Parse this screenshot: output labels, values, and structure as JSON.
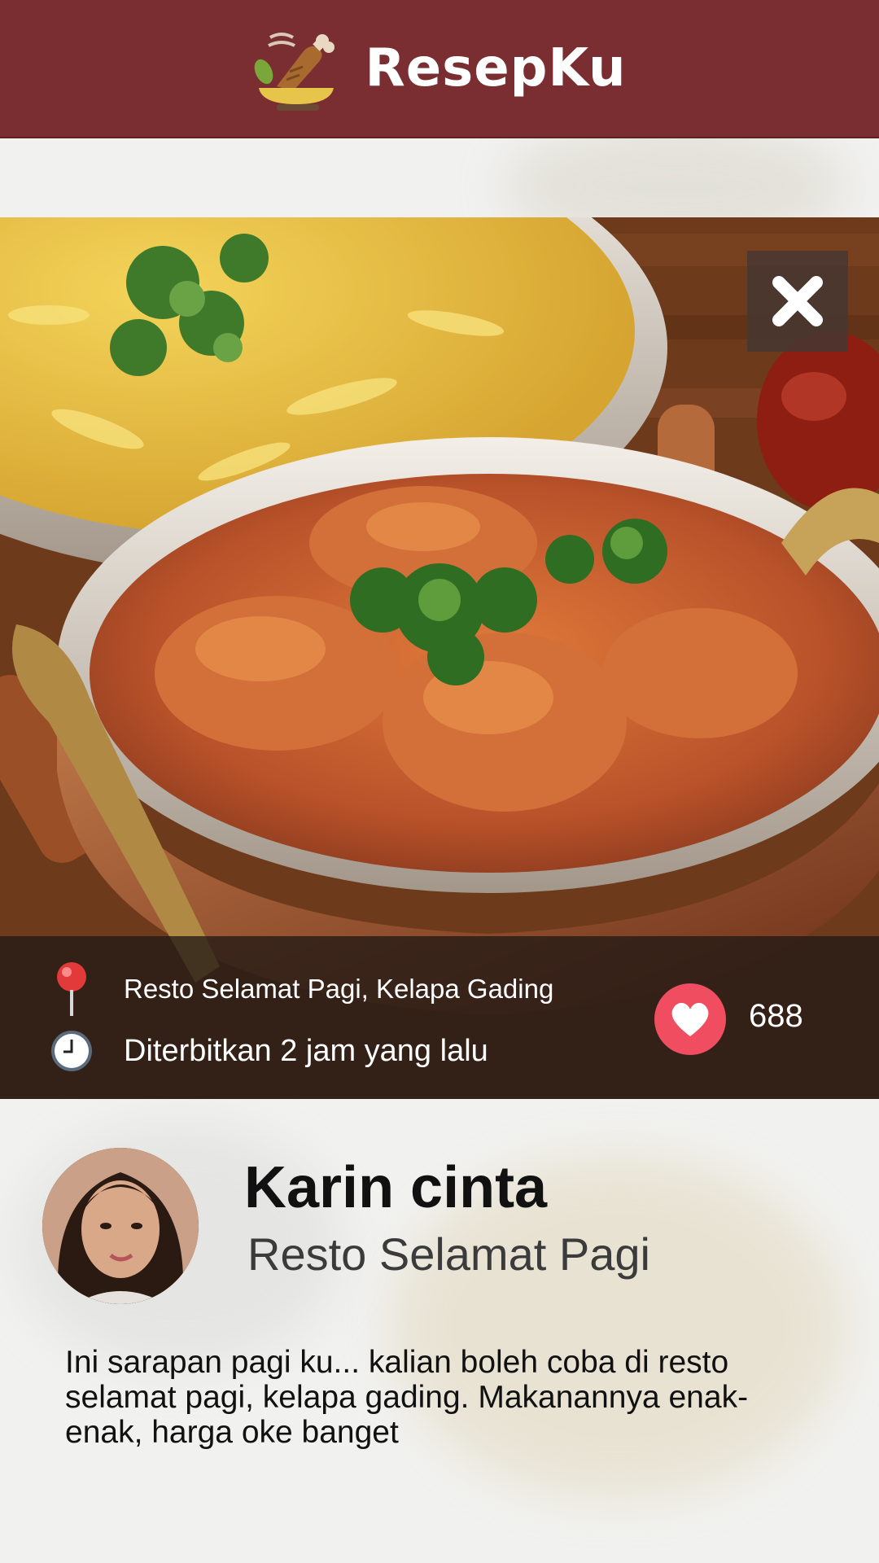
{
  "header": {
    "app_title": "ResepKu",
    "brand_color": "#7a2e31"
  },
  "post": {
    "location": "Resto Selamat Pagi, Kelapa Gading",
    "published": "Diterbitkan 2 jam yang lalu",
    "likes": "688",
    "like_color": "#f04e60"
  },
  "author": {
    "name": "Karin cinta",
    "place": "Resto Selamat Pagi"
  },
  "description": "Ini sarapan pagi ku... kalian boleh coba di resto selamat pagi, kelapa gading. Makanannya enak-enak, harga oke banget",
  "icons": {
    "logo": "food-logo-icon",
    "close": "close-icon",
    "location": "map-pin-icon",
    "time": "clock-icon",
    "like": "heart-icon"
  }
}
